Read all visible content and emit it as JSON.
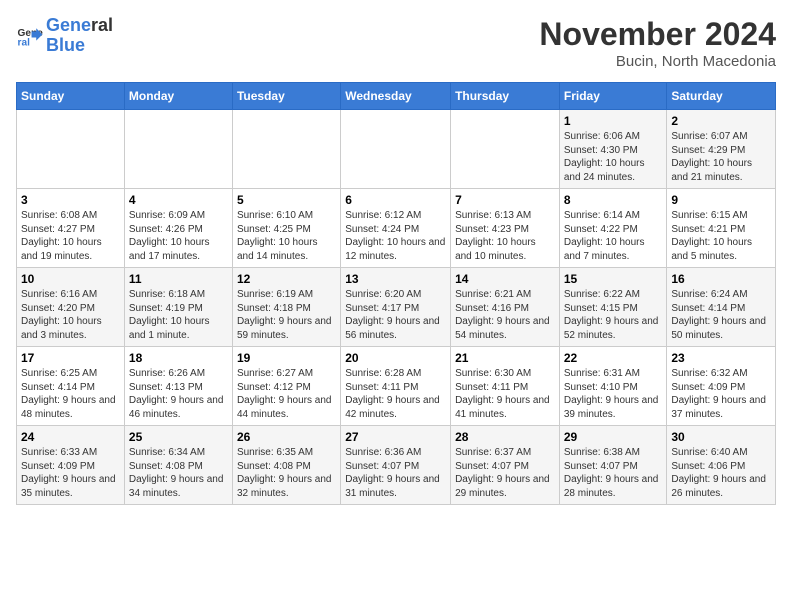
{
  "logo": {
    "line1": "General",
    "line2": "Blue"
  },
  "title": "November 2024",
  "subtitle": "Bucin, North Macedonia",
  "days_header": [
    "Sunday",
    "Monday",
    "Tuesday",
    "Wednesday",
    "Thursday",
    "Friday",
    "Saturday"
  ],
  "weeks": [
    [
      {
        "day": "",
        "info": ""
      },
      {
        "day": "",
        "info": ""
      },
      {
        "day": "",
        "info": ""
      },
      {
        "day": "",
        "info": ""
      },
      {
        "day": "",
        "info": ""
      },
      {
        "day": "1",
        "info": "Sunrise: 6:06 AM\nSunset: 4:30 PM\nDaylight: 10 hours and 24 minutes."
      },
      {
        "day": "2",
        "info": "Sunrise: 6:07 AM\nSunset: 4:29 PM\nDaylight: 10 hours and 21 minutes."
      }
    ],
    [
      {
        "day": "3",
        "info": "Sunrise: 6:08 AM\nSunset: 4:27 PM\nDaylight: 10 hours and 19 minutes."
      },
      {
        "day": "4",
        "info": "Sunrise: 6:09 AM\nSunset: 4:26 PM\nDaylight: 10 hours and 17 minutes."
      },
      {
        "day": "5",
        "info": "Sunrise: 6:10 AM\nSunset: 4:25 PM\nDaylight: 10 hours and 14 minutes."
      },
      {
        "day": "6",
        "info": "Sunrise: 6:12 AM\nSunset: 4:24 PM\nDaylight: 10 hours and 12 minutes."
      },
      {
        "day": "7",
        "info": "Sunrise: 6:13 AM\nSunset: 4:23 PM\nDaylight: 10 hours and 10 minutes."
      },
      {
        "day": "8",
        "info": "Sunrise: 6:14 AM\nSunset: 4:22 PM\nDaylight: 10 hours and 7 minutes."
      },
      {
        "day": "9",
        "info": "Sunrise: 6:15 AM\nSunset: 4:21 PM\nDaylight: 10 hours and 5 minutes."
      }
    ],
    [
      {
        "day": "10",
        "info": "Sunrise: 6:16 AM\nSunset: 4:20 PM\nDaylight: 10 hours and 3 minutes."
      },
      {
        "day": "11",
        "info": "Sunrise: 6:18 AM\nSunset: 4:19 PM\nDaylight: 10 hours and 1 minute."
      },
      {
        "day": "12",
        "info": "Sunrise: 6:19 AM\nSunset: 4:18 PM\nDaylight: 9 hours and 59 minutes."
      },
      {
        "day": "13",
        "info": "Sunrise: 6:20 AM\nSunset: 4:17 PM\nDaylight: 9 hours and 56 minutes."
      },
      {
        "day": "14",
        "info": "Sunrise: 6:21 AM\nSunset: 4:16 PM\nDaylight: 9 hours and 54 minutes."
      },
      {
        "day": "15",
        "info": "Sunrise: 6:22 AM\nSunset: 4:15 PM\nDaylight: 9 hours and 52 minutes."
      },
      {
        "day": "16",
        "info": "Sunrise: 6:24 AM\nSunset: 4:14 PM\nDaylight: 9 hours and 50 minutes."
      }
    ],
    [
      {
        "day": "17",
        "info": "Sunrise: 6:25 AM\nSunset: 4:14 PM\nDaylight: 9 hours and 48 minutes."
      },
      {
        "day": "18",
        "info": "Sunrise: 6:26 AM\nSunset: 4:13 PM\nDaylight: 9 hours and 46 minutes."
      },
      {
        "day": "19",
        "info": "Sunrise: 6:27 AM\nSunset: 4:12 PM\nDaylight: 9 hours and 44 minutes."
      },
      {
        "day": "20",
        "info": "Sunrise: 6:28 AM\nSunset: 4:11 PM\nDaylight: 9 hours and 42 minutes."
      },
      {
        "day": "21",
        "info": "Sunrise: 6:30 AM\nSunset: 4:11 PM\nDaylight: 9 hours and 41 minutes."
      },
      {
        "day": "22",
        "info": "Sunrise: 6:31 AM\nSunset: 4:10 PM\nDaylight: 9 hours and 39 minutes."
      },
      {
        "day": "23",
        "info": "Sunrise: 6:32 AM\nSunset: 4:09 PM\nDaylight: 9 hours and 37 minutes."
      }
    ],
    [
      {
        "day": "24",
        "info": "Sunrise: 6:33 AM\nSunset: 4:09 PM\nDaylight: 9 hours and 35 minutes."
      },
      {
        "day": "25",
        "info": "Sunrise: 6:34 AM\nSunset: 4:08 PM\nDaylight: 9 hours and 34 minutes."
      },
      {
        "day": "26",
        "info": "Sunrise: 6:35 AM\nSunset: 4:08 PM\nDaylight: 9 hours and 32 minutes."
      },
      {
        "day": "27",
        "info": "Sunrise: 6:36 AM\nSunset: 4:07 PM\nDaylight: 9 hours and 31 minutes."
      },
      {
        "day": "28",
        "info": "Sunrise: 6:37 AM\nSunset: 4:07 PM\nDaylight: 9 hours and 29 minutes."
      },
      {
        "day": "29",
        "info": "Sunrise: 6:38 AM\nSunset: 4:07 PM\nDaylight: 9 hours and 28 minutes."
      },
      {
        "day": "30",
        "info": "Sunrise: 6:40 AM\nSunset: 4:06 PM\nDaylight: 9 hours and 26 minutes."
      }
    ]
  ]
}
